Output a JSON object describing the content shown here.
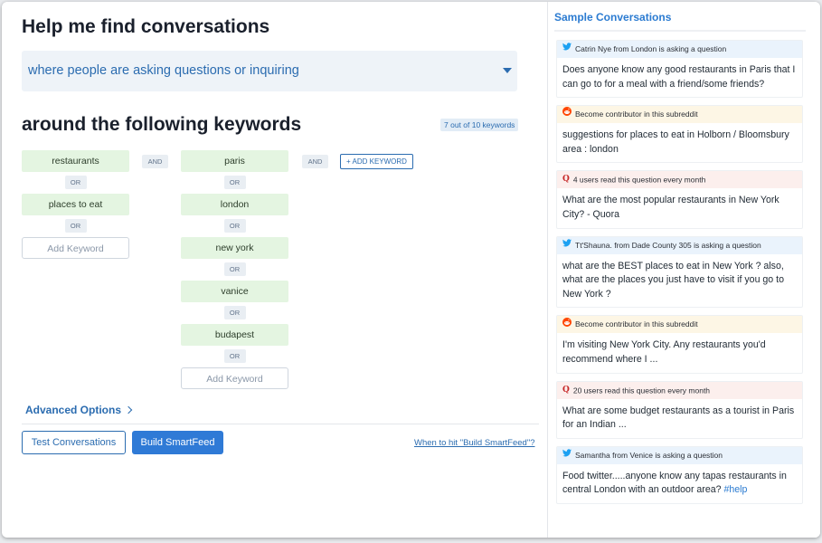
{
  "header": {
    "title": "Help me find conversations",
    "intent_select": "where people are asking questions or inquiring"
  },
  "keywords": {
    "title": "around the following keywords",
    "count_badge": "7 out of 10 keywords",
    "group1": [
      "restaurants",
      "places to eat"
    ],
    "group2": [
      "paris",
      "london",
      "new york",
      "vanice",
      "budapest"
    ],
    "or_label": "OR",
    "and_label": "AND",
    "add_keyword_placeholder": "Add Keyword",
    "add_keyword_button": "+ ADD KEYWORD"
  },
  "footer": {
    "advanced_options": "Advanced Options",
    "test_button": "Test Conversations",
    "build_button": "Build SmartFeed",
    "help_link": "When to hit \"Build SmartFeed\"?"
  },
  "sample": {
    "title": "Sample Conversations",
    "cards": [
      {
        "source": "twitter",
        "icon": "twitter-icon",
        "header": "Catrin Nye from London is asking a question",
        "text": "Does anyone know any good restaurants in Paris that I can go to for a meal with a friend/some friends?"
      },
      {
        "source": "reddit",
        "icon": "reddit-icon",
        "header": "Become contributor in this subreddit",
        "text": "suggestions for places to eat in Holborn / Bloomsbury area : london"
      },
      {
        "source": "quora",
        "icon": "quora-icon",
        "header": "4 users read this question every month",
        "text": "What are the most popular restaurants in New York City? - Quora"
      },
      {
        "source": "twitter",
        "icon": "twitter-icon",
        "header": "Tt'Shauna. from Dade County 305 is asking a question",
        "text": "what are the BEST places to eat in New York ? also, what are the places you just have to visit if you go to New York ?"
      },
      {
        "source": "reddit",
        "icon": "reddit-icon",
        "header": "Become contributor in this subreddit",
        "text": "I'm visiting New York City. Any restaurants you'd recommend where I ..."
      },
      {
        "source": "quora",
        "icon": "quora-icon",
        "header": "20 users read this question every month",
        "text": "What are some budget restaurants as a tourist in Paris for an Indian ..."
      },
      {
        "source": "twitter",
        "icon": "twitter-icon",
        "header": "Samantha from Venice is asking a question",
        "text": "Food twitter.....anyone know any tapas restaurants in central London with an outdoor area?",
        "hashtag": "#help"
      }
    ]
  },
  "colors": {
    "accent": "#2b6cb0",
    "primary_button": "#2f7ad6",
    "keyword_bg": "#e4f5e1",
    "twitter_bg": "#eaf3fc",
    "reddit_bg": "#fdf6e5",
    "quora_bg": "#fcefed"
  }
}
